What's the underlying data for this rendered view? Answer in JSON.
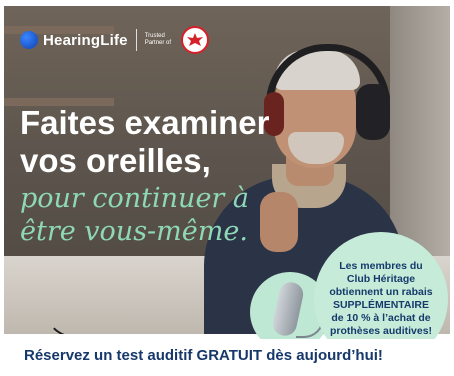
{
  "brand": {
    "name": "HearingLife",
    "trusted_partner": "Trusted Partner of",
    "partner_logo": "club-heritage-seal"
  },
  "headline": {
    "line1": "Faites examiner",
    "line2": "vos oreilles,",
    "tagline1": "pour continuer à",
    "tagline2": "être vous-même."
  },
  "promo": {
    "line1": "Les membres du",
    "line2": "Club Héritage",
    "line3": "obtiennent un rabais",
    "line4": "SUPPLÉMENTAIRE",
    "line5": "de 10 % à l’achat de",
    "line6": "prothèses auditives!"
  },
  "cta": {
    "text": "Réservez un test auditif GRATUIT dès aujourd’hui!"
  },
  "colors": {
    "brand_blue": "#1b55c7",
    "headline_white": "#ffffff",
    "tagline_mint": "#8fd8b6",
    "promo_bg": "#c6ebd9",
    "cta_navy": "#17386a",
    "partner_red": "#d6202c"
  },
  "icons": {
    "brand": "hearinglife-dot-icon",
    "partner": "club-heritage-seal-icon",
    "product": "hearing-aid-icon"
  }
}
